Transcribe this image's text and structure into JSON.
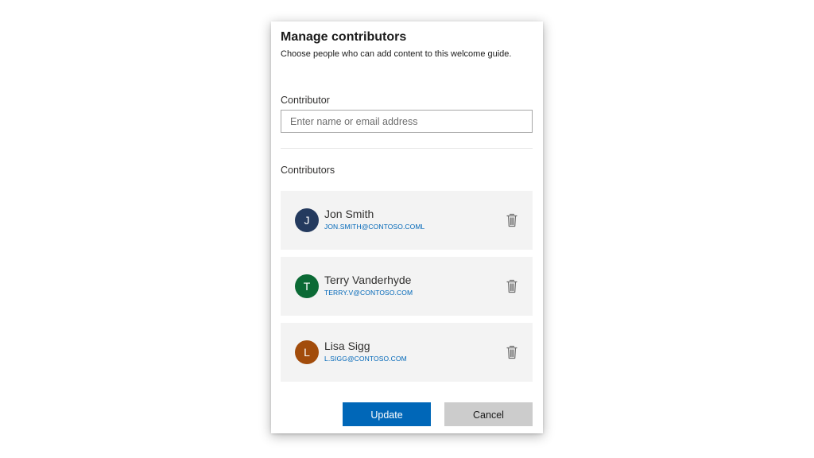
{
  "dialog": {
    "title": "Manage contributors",
    "subtitle": "Choose people who can add content to this welcome guide."
  },
  "contributor_field": {
    "label": "Contributor",
    "placeholder": "Enter name or email address",
    "value": ""
  },
  "contributors_section": {
    "label": "Contributors",
    "items": [
      {
        "initial": "J",
        "name": "Jon Smith",
        "email": "JON.SMITH@CONTOSO.COML",
        "avatar_color": "#243a5e",
        "delete_icon": "trash-icon"
      },
      {
        "initial": "T",
        "name": "Terry Vanderhyde",
        "email": "TERRY.V@CONTOSO.COM",
        "avatar_color": "#0b6a35",
        "delete_icon": "trash-icon"
      },
      {
        "initial": "L",
        "name": "Lisa Sigg",
        "email": "L.SIGG@CONTOSO.COM",
        "avatar_color": "#a24c0b",
        "delete_icon": "trash-icon"
      }
    ]
  },
  "actions": {
    "update_label": "Update",
    "cancel_label": "Cancel"
  },
  "colors": {
    "accent": "#0067b8",
    "card_background": "#f3f3f3",
    "cancel_background": "#cccccc"
  }
}
